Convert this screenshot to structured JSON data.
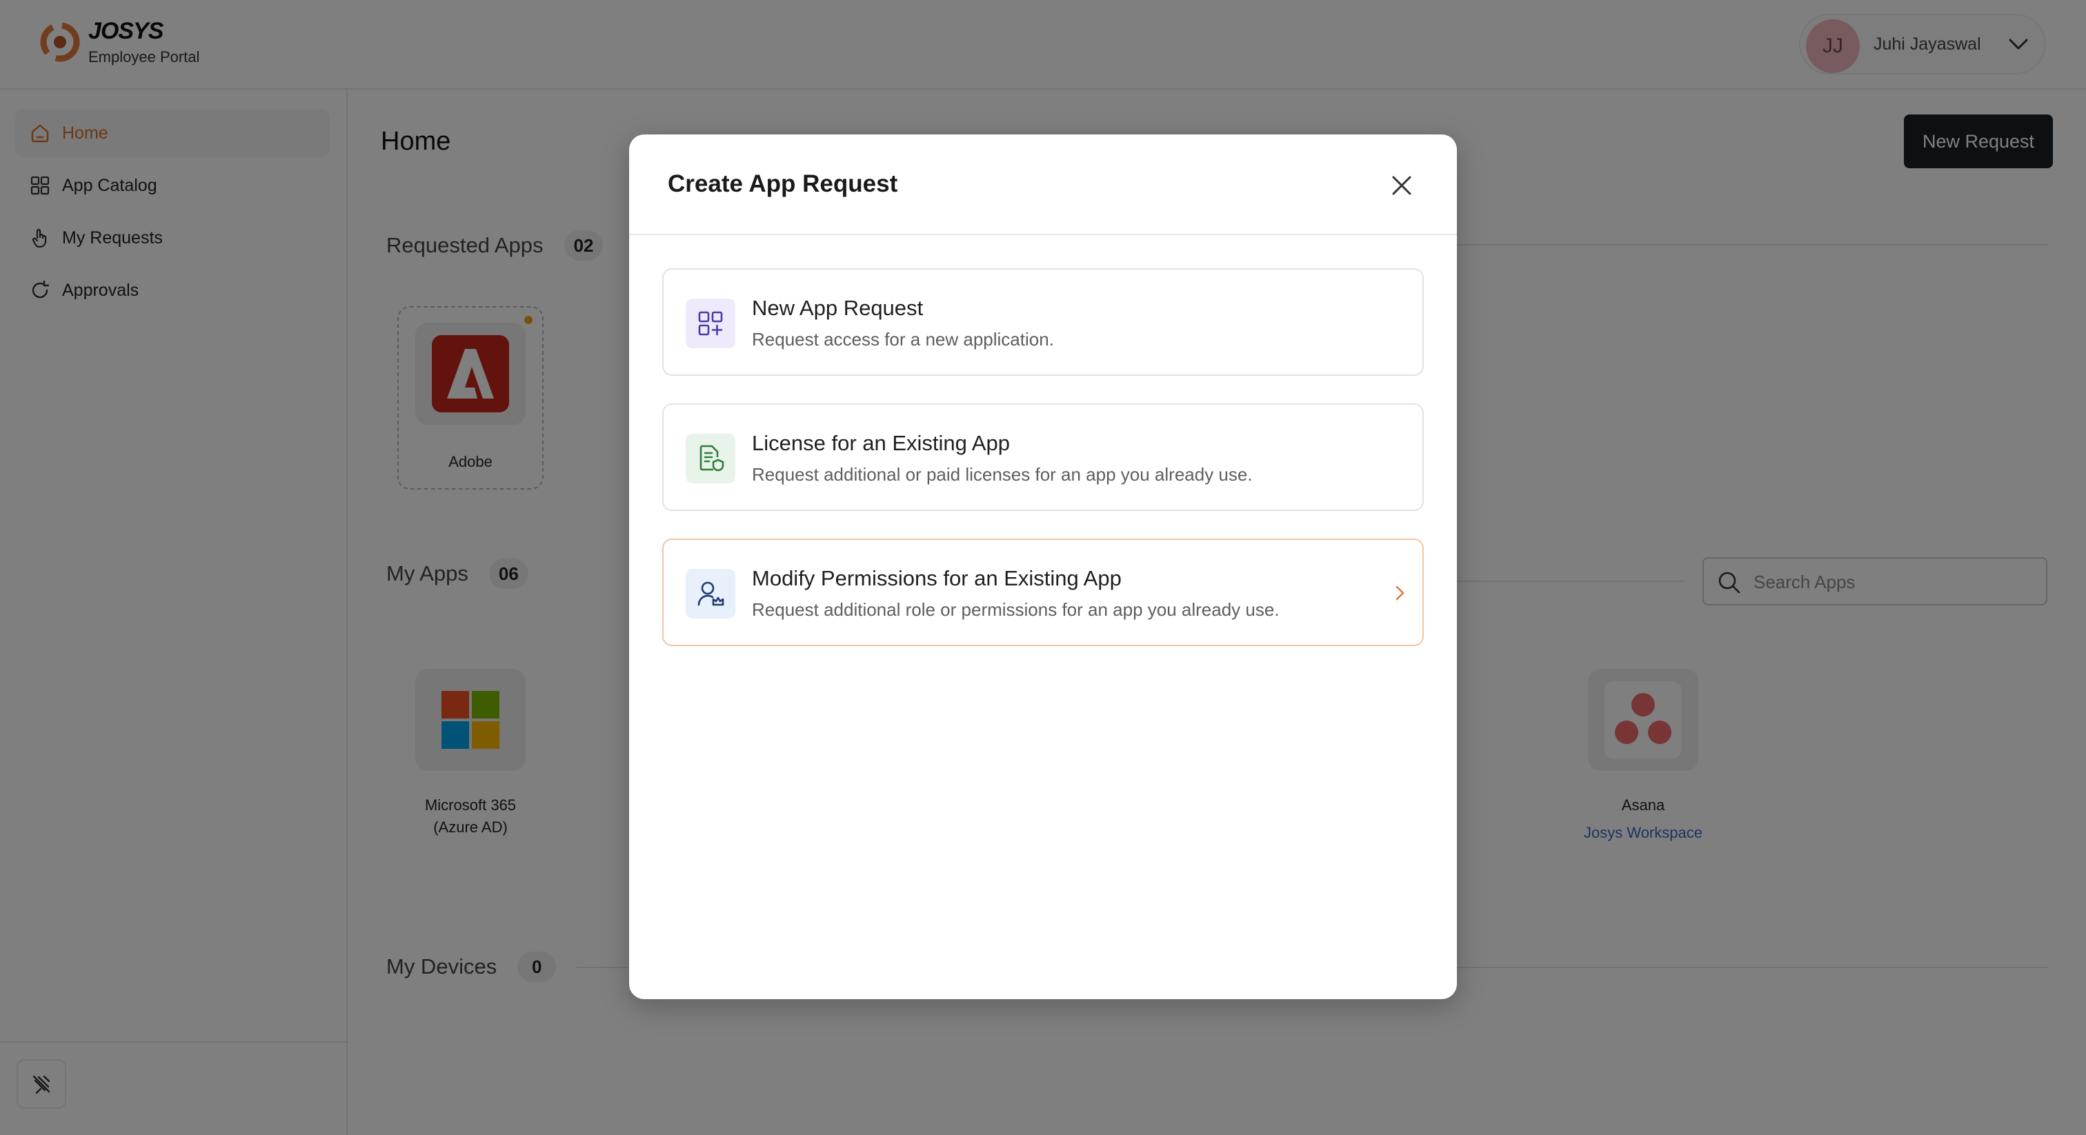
{
  "brand": {
    "name": "JOSYS",
    "subtitle": "Employee Portal"
  },
  "user": {
    "initials": "JJ",
    "name": "Juhi Jayaswal"
  },
  "sidebar": {
    "items": [
      {
        "label": "Home",
        "icon": "home-icon",
        "active": true
      },
      {
        "label": "App Catalog",
        "icon": "grid-icon",
        "active": false
      },
      {
        "label": "My Requests",
        "icon": "hand-pointer-icon",
        "active": false
      },
      {
        "label": "Approvals",
        "icon": "refresh-check-icon",
        "active": false
      }
    ]
  },
  "main": {
    "title": "Home",
    "new_request_label": "New Request",
    "requested_apps": {
      "title": "Requested Apps",
      "count": "02",
      "apps": [
        {
          "name": "Adobe"
        }
      ]
    },
    "my_apps": {
      "title": "My Apps",
      "count": "06",
      "search_placeholder": "Search Apps",
      "apps": [
        {
          "name": "Microsoft 365 (Azure AD)"
        },
        {
          "name": "Asana",
          "workspace": "Josys Workspace"
        }
      ]
    },
    "my_devices": {
      "title": "My Devices",
      "count": "0"
    }
  },
  "modal": {
    "title": "Create App Request",
    "options": [
      {
        "title": "New App Request",
        "description": "Request access for a new application."
      },
      {
        "title": "License for an Existing App",
        "description": "Request additional or paid licenses for an app you already use."
      },
      {
        "title": "Modify Permissions for an Existing App",
        "description": "Request additional role or permissions for an app you already use."
      }
    ]
  },
  "colors": {
    "accent": "#d9702a",
    "primary_button": "#182026",
    "link": "#3a66c4"
  }
}
